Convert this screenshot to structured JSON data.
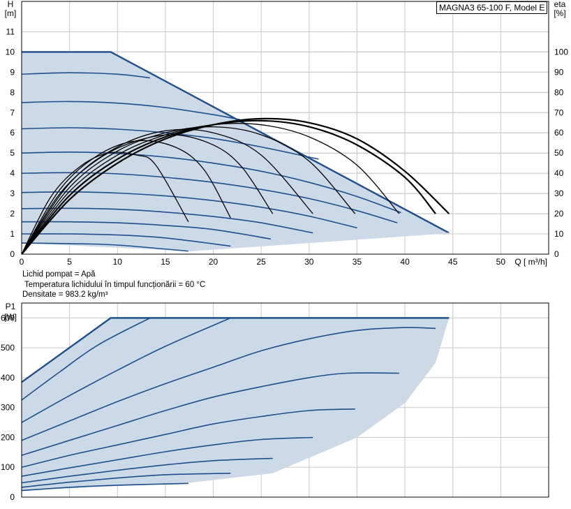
{
  "model_label": "MAGNA3 65-100 F, Model E",
  "info": {
    "liquid": "Lichid pompat = Apă",
    "temperature": "Temperatura lichidului în timpul funcționării = 60 °C",
    "density": "Densitate = 983.2  kg/m³"
  },
  "colors": {
    "curve": "#1f4e8c",
    "area": "#ccd9e6",
    "efficiency": "#000000",
    "grid": "#c8c8c8"
  },
  "chart_data": [
    {
      "type": "line",
      "title": "",
      "ylabel_left": "H",
      "ylabel_left_unit": "[m]",
      "ylabel_right": "eta",
      "ylabel_right_unit": "[%]",
      "xlabel": "Q [ m³/h]",
      "xlim": [
        0,
        55
      ],
      "ylim": [
        0,
        12.5
      ],
      "ylim_right": [
        0,
        125
      ],
      "x_ticks": [
        0,
        5,
        10,
        15,
        20,
        25,
        30,
        35,
        40,
        45,
        50
      ],
      "y_ticks": [
        0,
        1,
        2,
        3,
        4,
        5,
        6,
        7,
        8,
        9,
        10,
        11
      ],
      "y_ticks_right": [
        0,
        10,
        20,
        30,
        40,
        50,
        60,
        70,
        80,
        90,
        100
      ],
      "grid": true,
      "max_curve": {
        "x": [
          0,
          9.3,
          44.6
        ],
        "y": [
          10.0,
          10.0,
          1.05
        ]
      },
      "min_curve": {
        "x": [
          17.4,
          44.6
        ],
        "y": [
          0.15,
          1.05
        ]
      },
      "head_curves": [
        {
          "x": [
            0,
            5,
            10,
            13.4
          ],
          "y": [
            8.9,
            8.97,
            8.9,
            8.72
          ]
        },
        {
          "x": [
            0,
            5,
            10,
            15,
            20,
            22.8
          ],
          "y": [
            7.5,
            7.55,
            7.47,
            7.25,
            6.9,
            6.65
          ]
        },
        {
          "x": [
            0,
            5,
            10,
            15,
            20,
            25,
            31.0
          ],
          "y": [
            6.2,
            6.25,
            6.18,
            6.0,
            5.72,
            5.3,
            4.7
          ]
        },
        {
          "x": [
            0,
            5,
            10,
            15,
            20,
            25,
            30,
            35,
            39.6
          ],
          "y": [
            5.0,
            5.05,
            4.98,
            4.8,
            4.5,
            4.1,
            3.55,
            2.85,
            2.05
          ]
        },
        {
          "x": [
            0,
            5,
            10,
            15,
            20,
            25,
            30,
            35,
            39.2
          ],
          "y": [
            4.0,
            4.03,
            3.97,
            3.8,
            3.55,
            3.2,
            2.75,
            2.15,
            1.55
          ]
        },
        {
          "x": [
            0,
            5,
            10,
            15,
            20,
            25,
            30,
            35
          ],
          "y": [
            3.05,
            3.08,
            3.02,
            2.88,
            2.65,
            2.32,
            1.88,
            1.3
          ]
        },
        {
          "x": [
            0,
            5,
            10,
            15,
            20,
            25,
            30.4
          ],
          "y": [
            2.25,
            2.27,
            2.22,
            2.08,
            1.86,
            1.55,
            1.05
          ]
        },
        {
          "x": [
            0,
            5,
            10,
            15,
            20,
            26.0
          ],
          "y": [
            1.6,
            1.6,
            1.55,
            1.42,
            1.22,
            0.75
          ]
        },
        {
          "x": [
            0,
            5,
            10,
            15,
            21.8
          ],
          "y": [
            1.0,
            1.0,
            0.95,
            0.8,
            0.4
          ]
        },
        {
          "x": [
            0,
            5,
            10,
            17.4
          ],
          "y": [
            0.55,
            0.52,
            0.45,
            0.15
          ]
        }
      ],
      "efficiency_curves": [
        {
          "x": [
            0,
            3,
            6,
            9,
            12,
            14,
            17.4
          ],
          "y": [
            0,
            28,
            43,
            50,
            49,
            44,
            16
          ]
        },
        {
          "x": [
            0,
            4,
            8,
            12,
            16,
            19,
            21.8
          ],
          "y": [
            0,
            32,
            49,
            56,
            53,
            42,
            18
          ]
        },
        {
          "x": [
            0,
            4,
            8,
            12,
            16,
            20,
            23,
            26.2
          ],
          "y": [
            0,
            30,
            47,
            56,
            59,
            54,
            43,
            20
          ]
        },
        {
          "x": [
            0,
            5,
            10,
            15,
            20,
            25,
            30.4
          ],
          "y": [
            0,
            35,
            53,
            61,
            60,
            49,
            20
          ]
        },
        {
          "x": [
            0,
            5,
            10,
            15,
            20,
            25,
            30,
            34.8
          ],
          "y": [
            0,
            33,
            51,
            60,
            63,
            59,
            46,
            20
          ]
        },
        {
          "x": [
            0,
            5,
            10,
            15,
            20,
            25,
            30,
            35,
            39.4
          ],
          "y": [
            0,
            31,
            49,
            59,
            64,
            64,
            58,
            44,
            20
          ]
        },
        {
          "x": [
            0,
            5,
            10,
            15,
            20,
            25,
            30,
            35,
            40,
            43.2
          ],
          "y": [
            0,
            29,
            47,
            58,
            64,
            66,
            63,
            54,
            38,
            20
          ]
        },
        {
          "x": [
            0,
            5,
            10,
            15,
            20,
            25,
            30,
            35,
            40,
            44.6
          ],
          "y": [
            0,
            27,
            45,
            57,
            64,
            67,
            65,
            57,
            41,
            20
          ]
        }
      ]
    },
    {
      "type": "line",
      "title": "",
      "ylabel": "P1",
      "ylabel_unit": "[W]",
      "xlim": [
        0,
        55
      ],
      "ylim": [
        0,
        650
      ],
      "x_ticks": [
        0,
        5,
        10,
        15,
        20,
        25,
        30,
        35,
        40,
        45,
        50
      ],
      "y_ticks": [
        0,
        100,
        200,
        300,
        400,
        500,
        600
      ],
      "grid": true,
      "max_curve": {
        "x": [
          0,
          9.3,
          44.6
        ],
        "y": [
          385,
          600,
          600
        ]
      },
      "min_curve": {
        "x": [
          17.4,
          26.2,
          35,
          40,
          43.2,
          44.6
        ],
        "y": [
          48,
          80,
          200,
          315,
          450,
          600
        ]
      },
      "power_curves": [
        {
          "x": [
            0,
            4,
            8,
            13.4
          ],
          "y": [
            325,
            420,
            510,
            600
          ]
        },
        {
          "x": [
            0,
            5,
            10,
            15,
            21.8
          ],
          "y": [
            250,
            340,
            425,
            505,
            600
          ]
        },
        {
          "x": [
            0,
            5,
            10,
            15,
            20,
            25,
            30,
            35,
            40,
            43.2
          ],
          "y": [
            190,
            255,
            320,
            380,
            435,
            490,
            530,
            558,
            568,
            565
          ]
        },
        {
          "x": [
            0,
            5,
            10,
            15,
            20,
            25,
            30,
            34,
            39.4
          ],
          "y": [
            140,
            190,
            240,
            290,
            335,
            370,
            400,
            415,
            415
          ]
        },
        {
          "x": [
            0,
            5,
            10,
            15,
            20,
            25,
            30,
            34.8
          ],
          "y": [
            100,
            140,
            175,
            210,
            245,
            270,
            290,
            295
          ]
        },
        {
          "x": [
            0,
            5,
            10,
            15,
            20,
            25,
            30.4
          ],
          "y": [
            70,
            98,
            125,
            152,
            175,
            193,
            200
          ]
        },
        {
          "x": [
            0,
            5,
            10,
            15,
            20,
            26.2
          ],
          "y": [
            48,
            70,
            90,
            108,
            122,
            130
          ]
        },
        {
          "x": [
            0,
            5,
            10,
            15,
            21.8
          ],
          "y": [
            33,
            50,
            64,
            75,
            80
          ]
        },
        {
          "x": [
            0,
            5,
            10,
            17.4
          ],
          "y": [
            22,
            33,
            40,
            46
          ]
        }
      ]
    }
  ]
}
